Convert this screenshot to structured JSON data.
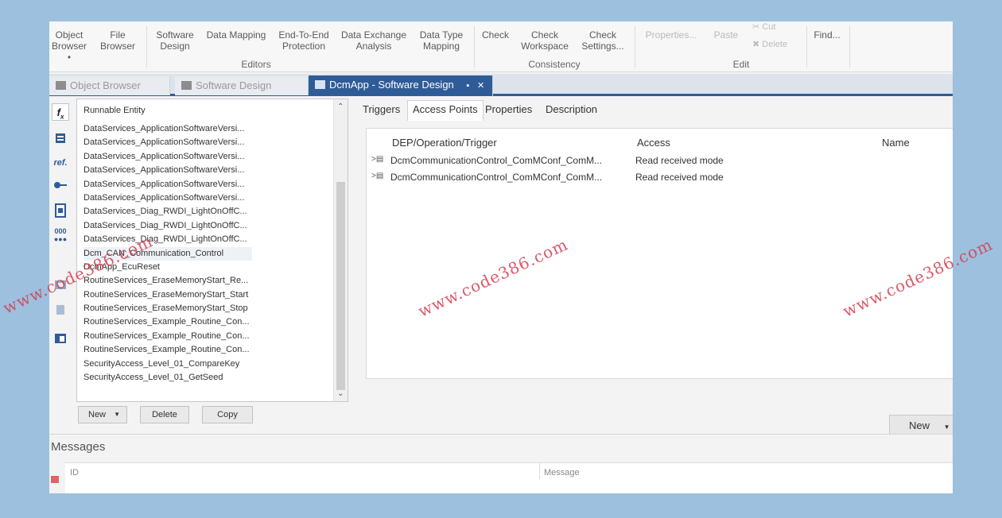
{
  "ribbon": {
    "buttons": {
      "object_browser": "Object\nBrowser •",
      "file_browser": "File\nBrowser",
      "software_design": "Software\nDesign",
      "data_mapping": "Data Mapping",
      "end_to_end": "End-To-End\nProtection",
      "data_exchange": "Data Exchange\nAnalysis",
      "data_type_mapping": "Data Type\nMapping",
      "check": "Check",
      "check_workspace": "Check\nWorkspace",
      "check_settings": "Check\nSettings...",
      "properties": "Properties...",
      "paste": "Paste",
      "cut": "Cut",
      "delete": "Delete",
      "find": "Find..."
    },
    "groups": {
      "editors": "Editors",
      "consistency": "Consistency",
      "edit": "Edit"
    }
  },
  "doc_tabs": [
    {
      "label": "Object Browser"
    },
    {
      "label": "Software Design"
    },
    {
      "label": "DcmApp - Software Design"
    }
  ],
  "active_tab_controls": {
    "pin": "▪",
    "close": "✕"
  },
  "left_toolbar": {
    "icons": [
      "fx-icon",
      "database-icon",
      "ref-icon",
      "port-icon",
      "component-icon",
      "binary-icon",
      "module-icon",
      "layers-icon",
      "window-icon"
    ],
    "fx": "f",
    "ref": "ref."
  },
  "entity_panel": {
    "header": "Runnable Entity",
    "items": [
      "DataServices_ApplicationSoftwareVersi...",
      "DataServices_ApplicationSoftwareVersi...",
      "DataServices_ApplicationSoftwareVersi...",
      "DataServices_ApplicationSoftwareVersi...",
      "DataServices_ApplicationSoftwareVersi...",
      "DataServices_ApplicationSoftwareVersi...",
      "DataServices_Diag_RWDI_LightOnOffC...",
      "DataServices_Diag_RWDI_LightOnOffC...",
      "DataServices_Diag_RWDI_LightOnOffC...",
      "Dcm_CAN_Communication_Control",
      "DcmApp_EcuReset",
      "RoutineServices_EraseMemoryStart_Re...",
      "RoutineServices_EraseMemoryStart_Start",
      "RoutineServices_EraseMemoryStart_Stop",
      "RoutineServices_Example_Routine_Con...",
      "RoutineServices_Example_Routine_Con...",
      "RoutineServices_Example_Routine_Con...",
      "SecurityAccess_Level_01_CompareKey",
      "SecurityAccess_Level_01_GetSeed"
    ],
    "buttons": {
      "new": "New",
      "delete": "Delete",
      "copy": "Copy"
    }
  },
  "detail": {
    "tabs": [
      "Triggers",
      "Access Points",
      "Properties",
      "Description"
    ],
    "columns": {
      "dep": "DEP/Operation/Trigger",
      "access": "Access",
      "name": "Name"
    },
    "rows": [
      {
        "dep": "DcmCommunicationControl_ComMConf_ComM...",
        "access": "Read received mode",
        "name": ""
      },
      {
        "dep": "DcmCommunicationControl_ComMConf_ComM...",
        "access": "Read received mode",
        "name": ""
      }
    ],
    "new_button": "New"
  },
  "messages": {
    "title": "Messages",
    "columns": {
      "id": "ID",
      "message": "Message"
    }
  },
  "watermark": "www.code386.com",
  "colors": {
    "accent": "#2f5c97",
    "background": "#9cc0de",
    "watermark": "#d63c50"
  }
}
